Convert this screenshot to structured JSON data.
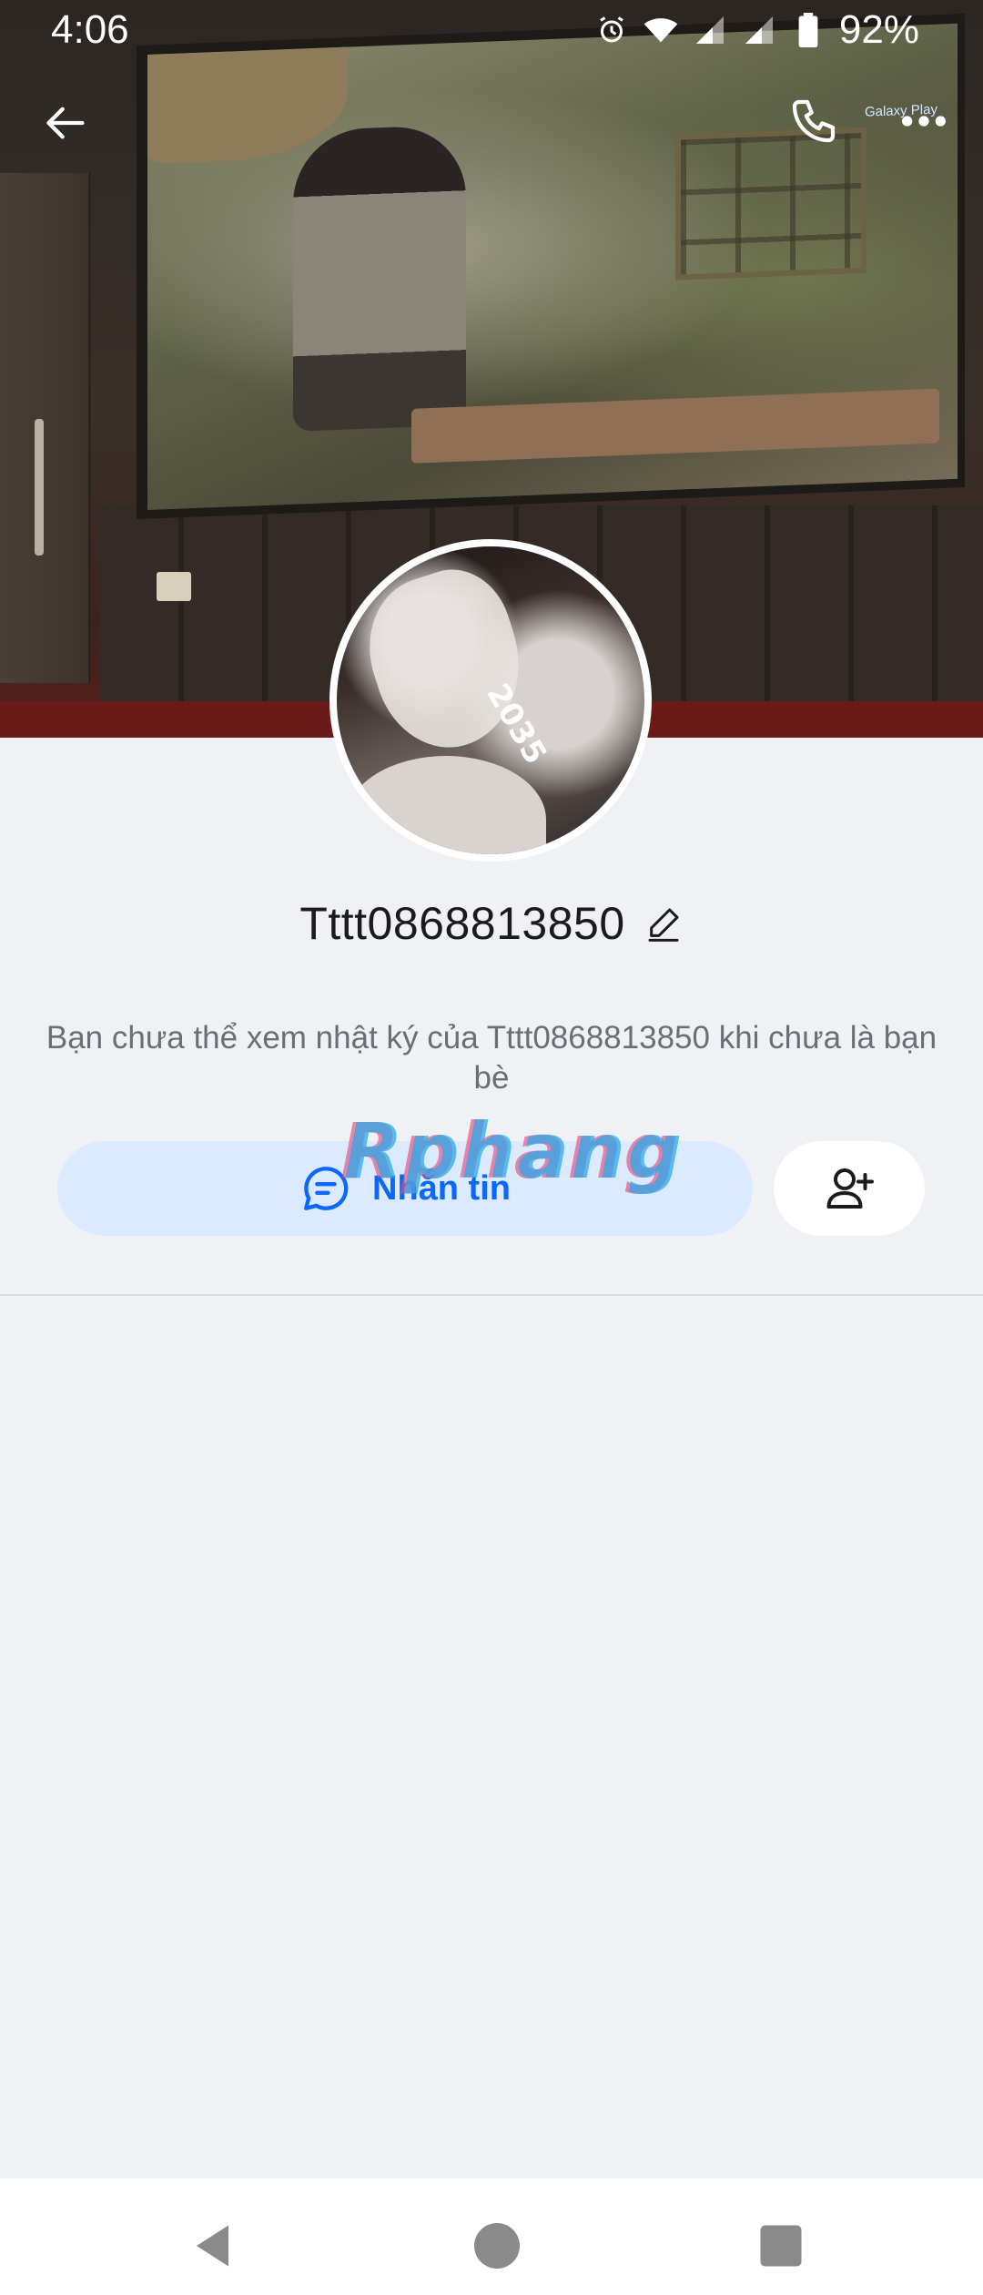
{
  "status_bar": {
    "time": "4:06",
    "battery_percent": "92%",
    "icons": [
      "alarm-icon",
      "wifi-icon",
      "signal-icon",
      "signal-icon",
      "battery-icon"
    ]
  },
  "app_bar": {
    "icons": [
      "back-arrow-icon",
      "phone-icon",
      "more-dots-icon"
    ]
  },
  "cover": {
    "watermark": "Galaxy Play"
  },
  "profile": {
    "name": "Tttt0868813850",
    "avatar_sticker": "2035",
    "info_text": "Bạn chưa thể xem nhật ký của Tttt0868813850 khi chưa là bạn bè"
  },
  "actions": {
    "message_label": "Nhắn tin",
    "brand_watermark": "Rphang"
  },
  "nav_bar": {
    "icons": [
      "nav-back-icon",
      "nav-home-icon",
      "nav-recents-icon"
    ]
  },
  "colors": {
    "accent": "#0a68ff",
    "message_button_bg": "#dbeaff",
    "page_bg": "#f0f1f5"
  }
}
